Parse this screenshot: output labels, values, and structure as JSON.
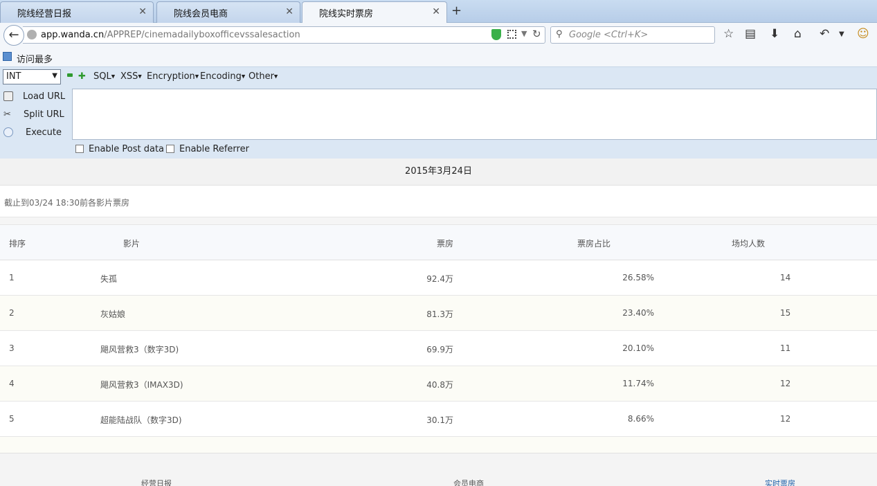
{
  "tabs": [
    {
      "label": "院线经营日报"
    },
    {
      "label": "院线会员电商"
    },
    {
      "label": "院线实时票房"
    }
  ],
  "new_tab_label": "+",
  "url": {
    "host": "app.wanda.cn",
    "path": "/APPREP/cinemadailyboxofficevssalesaction"
  },
  "search": {
    "placeholder": "Google <Ctrl+K>"
  },
  "bookmarks": {
    "most_visited": "访问最多"
  },
  "hackbar": {
    "select_value": "INT",
    "menus": [
      "SQL",
      "XSS",
      "Encryption",
      "Encoding",
      "Other"
    ],
    "buttons": {
      "load": "Load URL",
      "split": "Split URL",
      "execute": "Execute"
    },
    "checkboxes": {
      "post": "Enable Post data",
      "referrer": "Enable Referrer"
    }
  },
  "report": {
    "date": "2015年3月24日",
    "subtitle": "截止到03/24 18:30前各影片票房",
    "columns": {
      "rank": "排序",
      "film": "影片",
      "box": "票房",
      "share": "票房占比",
      "avg": "场均人数"
    },
    "rows": [
      {
        "rank": "1",
        "film": "失孤",
        "box": "92.4万",
        "share": "26.58%",
        "avg": "14"
      },
      {
        "rank": "2",
        "film": "灰姑娘",
        "box": "81.3万",
        "share": "23.40%",
        "avg": "15"
      },
      {
        "rank": "3",
        "film": "飓风营救3（数字3D)",
        "box": "69.9万",
        "share": "20.10%",
        "avg": "11"
      },
      {
        "rank": "4",
        "film": "飓风营救3（IMAX3D)",
        "box": "40.8万",
        "share": "11.74%",
        "avg": "12"
      },
      {
        "rank": "5",
        "film": "超能陆战队（数字3D)",
        "box": "30.1万",
        "share": "8.66%",
        "avg": "12"
      }
    ]
  },
  "footer": {
    "daily": "经营日报",
    "member": "会员电商",
    "realtime": "实时票房"
  }
}
